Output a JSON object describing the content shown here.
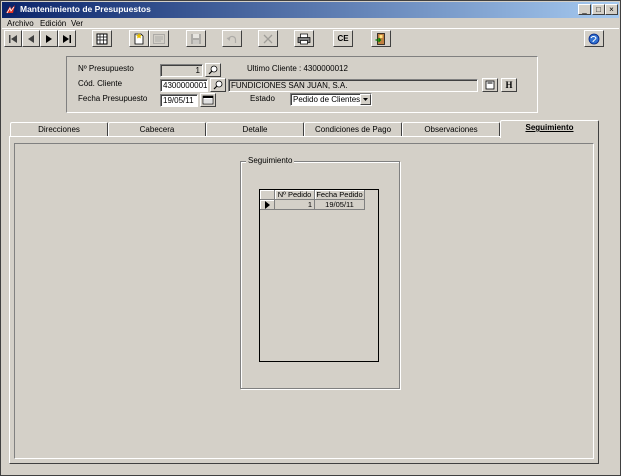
{
  "window": {
    "title": "Mantenimiento de Presupuestos",
    "minimize": "_",
    "maximize": "□",
    "close": "×"
  },
  "menu": [
    "Archivo",
    "Edición",
    "Ver"
  ],
  "toolbar": {
    "ce_label": "CE",
    "h_label": "H"
  },
  "header": {
    "presupuesto_label": "Nº Presupuesto",
    "presupuesto_value": "1",
    "ultimo_cliente": "Ultimo Cliente : 4300000012",
    "cliente_label": "Cód. Cliente",
    "cliente_code": "4300000001",
    "cliente_name": "FUNDICIONES SAN JUAN, S.A.",
    "fecha_label": "Fecha Presupuesto",
    "fecha_value": "19/05/11",
    "estado_label": "Estado",
    "estado_value": "Pedido de Clientes"
  },
  "tabs": [
    "Direcciones",
    "Cabecera",
    "Detalle",
    "Condiciones de Pago",
    "Observaciones",
    "Seguimiento"
  ],
  "active_tab": "Seguimiento",
  "seguimiento": {
    "group_title": "Seguimiento",
    "columns": [
      "Nº Pedido",
      "Fecha Pedido"
    ],
    "rows": [
      {
        "pedido": "1",
        "fecha": "19/05/11"
      }
    ]
  }
}
